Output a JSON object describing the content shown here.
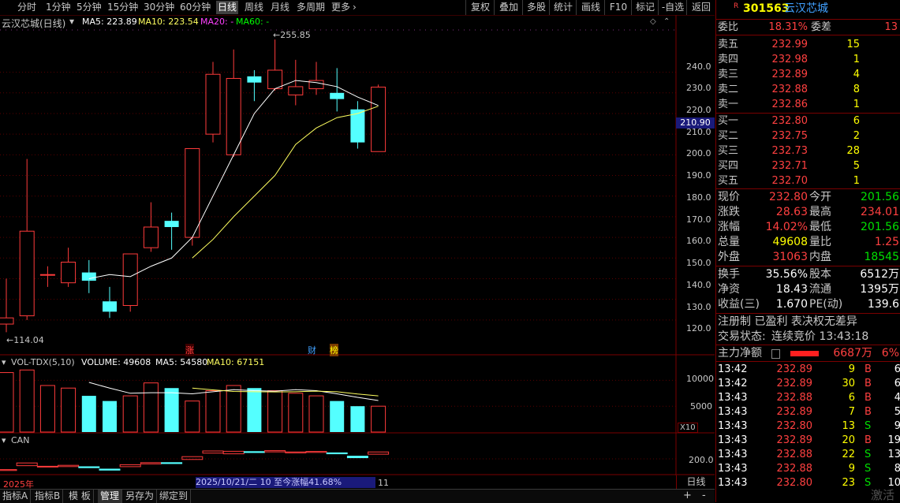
{
  "toolbar": {
    "periods": [
      "分时",
      "1分钟",
      "5分钟",
      "15分钟",
      "30分钟",
      "60分钟",
      "日线",
      "周线",
      "月线",
      "多周期",
      "更多"
    ],
    "active_period": "日线",
    "right_buttons": [
      "复权",
      "叠加",
      "多股",
      "统计",
      "画线",
      "F10",
      "标记",
      "-自选",
      "返回"
    ]
  },
  "chart": {
    "title": "云汉芯城(日线)",
    "ma_labels": {
      "ma5": "MA5: 223.89",
      "ma10": "MA10: 223.54",
      "ma20": "MA20: -",
      "ma60": "MA60: -"
    },
    "high_marker": "255.85",
    "low_marker": "114.04",
    "y_ticks": [
      "240.0",
      "230.0",
      "220.0",
      "210.0",
      "200.0",
      "190.0",
      "180.0",
      "170.0",
      "160.0",
      "150.0",
      "140.0",
      "130.0",
      "120.0"
    ],
    "current_price_tag": "210.90",
    "event_marks": [
      "涨",
      "财",
      "榜"
    ],
    "candles": [
      {
        "o": 118,
        "c": 121,
        "h": 140,
        "l": 114.04
      },
      {
        "o": 122,
        "c": 163,
        "h": 198,
        "l": 120
      },
      {
        "o": 142,
        "c": 142,
        "h": 146,
        "l": 136
      },
      {
        "o": 138,
        "c": 148,
        "h": 155,
        "l": 136
      },
      {
        "o": 143,
        "c": 139,
        "h": 149,
        "l": 133
      },
      {
        "o": 129,
        "c": 124,
        "h": 136,
        "l": 121
      },
      {
        "o": 127,
        "c": 152,
        "h": 152,
        "l": 124
      },
      {
        "o": 155,
        "c": 165,
        "h": 177,
        "l": 153
      },
      {
        "o": 168,
        "c": 165,
        "h": 172,
        "l": 154
      },
      {
        "o": 160,
        "c": 203,
        "h": 203,
        "l": 156
      },
      {
        "o": 210,
        "c": 239,
        "h": 245,
        "l": 206
      },
      {
        "o": 200,
        "c": 237,
        "h": 251,
        "l": 199
      },
      {
        "o": 238,
        "c": 235,
        "h": 241,
        "l": 226
      },
      {
        "o": 232,
        "c": 241,
        "h": 255.85,
        "l": 231
      },
      {
        "o": 229,
        "c": 233,
        "h": 246,
        "l": 224
      },
      {
        "o": 232,
        "c": 236,
        "h": 245,
        "l": 229
      },
      {
        "o": 230,
        "c": 227,
        "h": 242,
        "l": 221
      },
      {
        "o": 222,
        "c": 206,
        "h": 226,
        "l": 203
      },
      {
        "o": 201.56,
        "c": 232.8,
        "h": 234.01,
        "l": 201.56
      }
    ],
    "ma5_line": [
      null,
      null,
      null,
      null,
      140,
      142,
      141,
      146,
      150,
      160,
      180,
      200,
      220,
      232,
      236,
      235,
      233,
      228,
      223.89
    ],
    "ma10_line": [
      null,
      null,
      null,
      null,
      null,
      null,
      null,
      null,
      null,
      150,
      159,
      170,
      180,
      190,
      205,
      213,
      218,
      220,
      223.54
    ],
    "volume_panel": {
      "label": "VOL-TDX(5,10)",
      "volume": "VOLUME: 49608",
      "ma5": "MA5: 54580",
      "ma10": "MA10: 67151",
      "y_ticks": [
        "10000",
        "5000"
      ],
      "multiplier": "X10",
      "volumes": [
        11500,
        12000,
        9000,
        8500,
        7000,
        6000,
        7000,
        9500,
        8500,
        6000,
        8000,
        9000,
        8500,
        8000,
        7500,
        7000,
        6000,
        5000,
        5000
      ]
    },
    "can_panel": {
      "label": "CAN",
      "y_tick": "200.0"
    },
    "year_label": "2025年",
    "range_info": "2025/10/21/二 10 至今涨幅41.68%",
    "month_label": "11",
    "period_btn": "日线"
  },
  "bottom_tabs": [
    "指标A",
    "指标B",
    "模 板",
    "管理",
    "另存为",
    "绑定到"
  ],
  "bottom_icons": [
    "+",
    "-"
  ],
  "quote": {
    "code": "301563",
    "name": "云汉芯城",
    "weibi_label": "委比",
    "weibi": "18.31%",
    "weicha_label": "委差",
    "weicha": "13",
    "sells": [
      {
        "label": "卖五",
        "price": "232.99",
        "vol": "15"
      },
      {
        "label": "卖四",
        "price": "232.98",
        "vol": "1"
      },
      {
        "label": "卖三",
        "price": "232.89",
        "vol": "4"
      },
      {
        "label": "卖二",
        "price": "232.88",
        "vol": "8"
      },
      {
        "label": "卖一",
        "price": "232.86",
        "vol": "1"
      }
    ],
    "buys": [
      {
        "label": "买一",
        "price": "232.80",
        "vol": "6"
      },
      {
        "label": "买二",
        "price": "232.75",
        "vol": "2"
      },
      {
        "label": "买三",
        "price": "232.73",
        "vol": "28"
      },
      {
        "label": "买四",
        "price": "232.71",
        "vol": "5"
      },
      {
        "label": "买五",
        "price": "232.70",
        "vol": "1"
      }
    ],
    "stats": [
      {
        "l1": "现价",
        "v1": "232.80",
        "l2": "今开",
        "v2": "201.56"
      },
      {
        "l1": "涨跌",
        "v1": "28.63",
        "l2": "最高",
        "v2": "234.01"
      },
      {
        "l1": "涨幅",
        "v1": "14.02%",
        "l2": "最低",
        "v2": "201.56"
      },
      {
        "l1": "总量",
        "v1": "49608",
        "l2": "量比",
        "v2": "1.25"
      },
      {
        "l1": "外盘",
        "v1": "31063",
        "l2": "内盘",
        "v2": "18545"
      }
    ],
    "stats2": [
      {
        "l1": "换手",
        "v1": "35.56%",
        "l2": "股本",
        "v2": "6512万"
      },
      {
        "l1": "净资",
        "v1": "18.43",
        "l2": "流通",
        "v2": "1395万"
      },
      {
        "l1": "收益(三)",
        "v1": "1.670",
        "l2": "PE(动)",
        "v2": "139.6"
      }
    ],
    "notes": "注册制 已盈利 表决权无差异",
    "trade_status_label": "交易状态:",
    "trade_status": "连续竞价 13:43:18",
    "main_net_label": "主力净额",
    "main_net": "6687万",
    "main_net_pct": "6%",
    "ticks": [
      {
        "t": "13:42",
        "p": "232.89",
        "v": "9",
        "s": "B",
        "n": "6"
      },
      {
        "t": "13:42",
        "p": "232.89",
        "v": "30",
        "s": "B",
        "n": "6"
      },
      {
        "t": "13:43",
        "p": "232.88",
        "v": "6",
        "s": "B",
        "n": "4"
      },
      {
        "t": "13:43",
        "p": "232.89",
        "v": "7",
        "s": "B",
        "n": "5"
      },
      {
        "t": "13:43",
        "p": "232.80",
        "v": "13",
        "s": "S",
        "n": "9"
      },
      {
        "t": "13:43",
        "p": "232.89",
        "v": "20",
        "s": "B",
        "n": "19"
      },
      {
        "t": "13:43",
        "p": "232.88",
        "v": "22",
        "s": "S",
        "n": "13"
      },
      {
        "t": "13:43",
        "p": "232.88",
        "v": "9",
        "s": "S",
        "n": "8"
      },
      {
        "t": "13:43",
        "p": "232.80",
        "v": "23",
        "s": "S",
        "n": "10"
      }
    ],
    "watermark": "激活"
  },
  "colors": {
    "up": "#ff3b3b",
    "down": "#54ffff",
    "ma5": "#ffffff",
    "ma10": "#ffff60",
    "ma20": "#ff40ff",
    "ma60": "#00ff00",
    "grid": "#5a0000"
  }
}
